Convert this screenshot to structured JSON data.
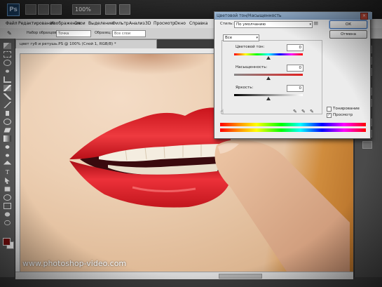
{
  "menu": [
    "Файл",
    "Редактирование",
    "Изображение",
    "Слои",
    "Выделение",
    "Фильтр",
    "Анализ",
    "3D",
    "Просмотр",
    "Окно",
    "Справка"
  ],
  "appbar": {
    "zoom": "100%"
  },
  "options": {
    "label1": "Набор образцов:",
    "field1": "Точка",
    "label2": "Образец:",
    "field2": "Все слои"
  },
  "document": {
    "tab_title": "цвет губ и ретушь.PS @ 100% (Слой 1, RGB/8) *"
  },
  "watermark": "www.photoshop-video.com",
  "dialog": {
    "title": "Цветовой тон/Насыщенность",
    "style_label": "Стиль:",
    "style_value": "По умолчанию",
    "ok": "ОК",
    "cancel": "Отмена",
    "channel": "Все",
    "hue_label": "Цветовой тон:",
    "hue_value": "0",
    "sat_label": "Насыщенность:",
    "sat_value": "0",
    "light_label": "Яркость:",
    "light_value": "0",
    "colorize_label": "Тонирование",
    "preview_label": "Просмотр",
    "preview_checked": "✓"
  },
  "colors": {
    "accent": "#7f9cbd",
    "lip": "#e0242a",
    "swatch_fg": "#7a0d0d"
  }
}
